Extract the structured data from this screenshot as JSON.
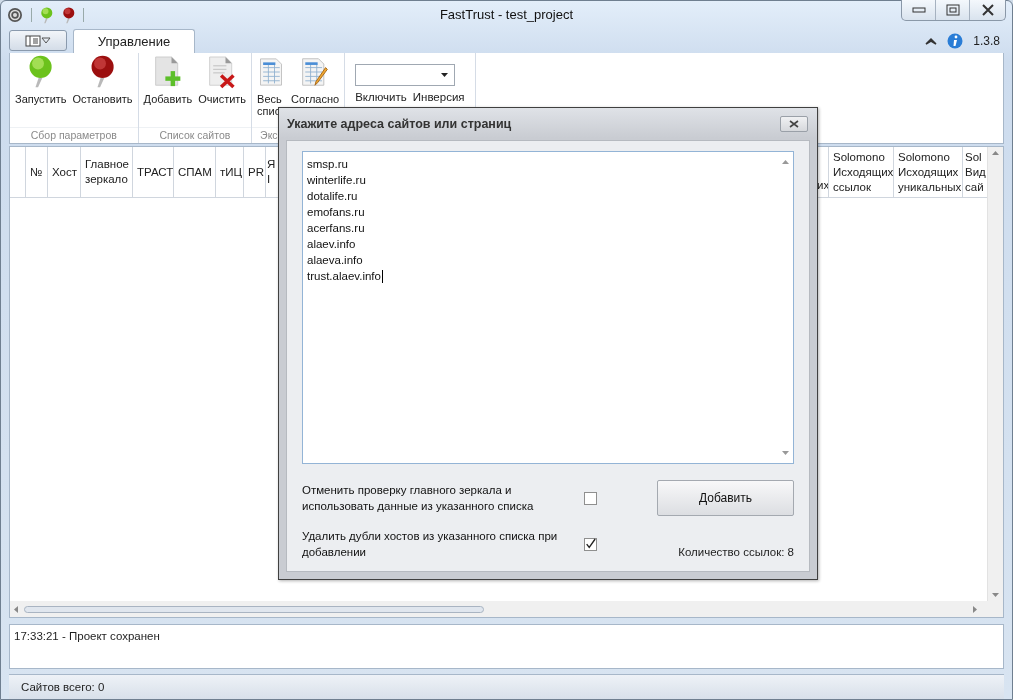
{
  "window": {
    "title": "FastTrust - test_project"
  },
  "tabs": [
    {
      "label": "Управление",
      "selected": true
    }
  ],
  "version": "1.3.8",
  "ribbon": {
    "groups": [
      {
        "label": "Сбор параметров",
        "buttons": [
          {
            "kind": "start",
            "label": "Запустить"
          },
          {
            "kind": "stop",
            "label": "Остановить"
          }
        ]
      },
      {
        "label": "Список сайтов",
        "buttons": [
          {
            "kind": "add",
            "label": "Добавить"
          },
          {
            "kind": "clear",
            "label": "Очистить"
          }
        ]
      },
      {
        "label": "Экс",
        "buttons": [
          {
            "kind": "table",
            "label": "Весь\nспис"
          },
          {
            "kind": "table-edit",
            "label": "Согласно"
          }
        ]
      },
      {
        "kind": "filter",
        "buttons": [
          {
            "label": "Включить"
          },
          {
            "label": "Инверсия"
          }
        ]
      }
    ]
  },
  "table": {
    "columns": [
      "№",
      "Хост",
      "Главное зеркало",
      "ТРАСТ",
      "СПАМ",
      "тИЦ",
      "PR",
      "Я I"
    ],
    "columns_right": [
      "их",
      "Solomono Исходящих ссылок",
      "Solomono Исходящих уникальных",
      "Sol Вид сай"
    ]
  },
  "log": [
    "17:33:21 - Проект сохранен"
  ],
  "status_bar": "Сайтов всего: 0",
  "dialog": {
    "title": "Укажите адреса сайтов или страниц",
    "lines": [
      "smsp.ru",
      "winterlife.ru",
      "dotalife.ru",
      "emofans.ru",
      "acerfans.ru",
      "alaev.info",
      "alaeva.info",
      "trust.alaev.info"
    ],
    "options": [
      {
        "label": "Отменить проверку главного зеркала и использовать данные из указанного списка",
        "checked": false
      },
      {
        "label": "Удалить дубли хостов из указанного списка при добавлении",
        "checked": true
      }
    ],
    "button": "Добавить",
    "count": "Количество ссылок: 8"
  }
}
